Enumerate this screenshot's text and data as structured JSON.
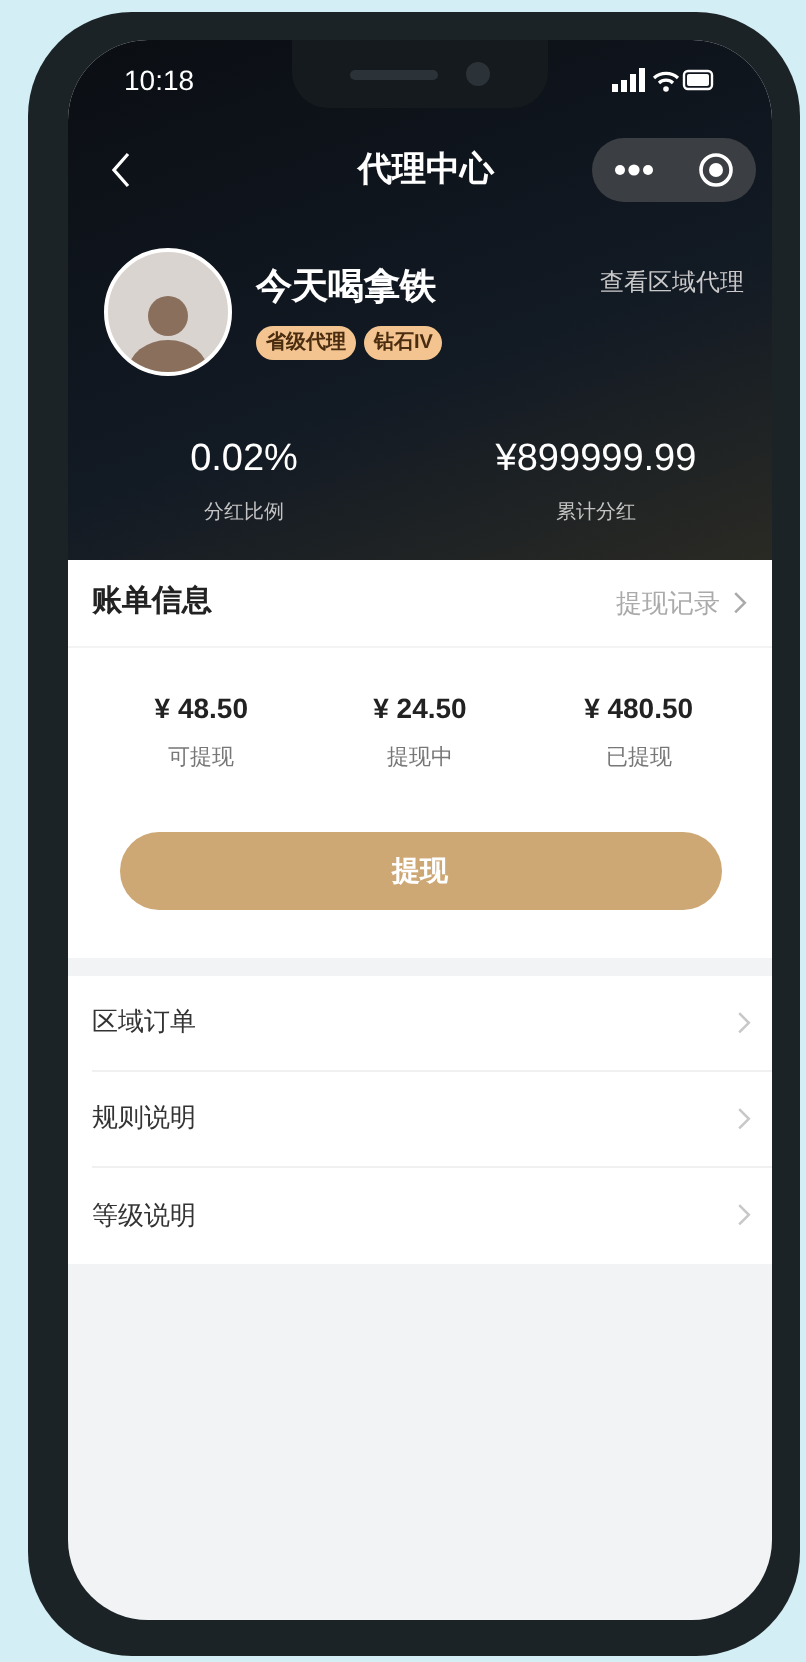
{
  "status_bar": {
    "time": "10:18"
  },
  "nav": {
    "title": "代理中心"
  },
  "profile": {
    "name": "今天喝拿铁",
    "badges": [
      "省级代理",
      "钻石IV"
    ],
    "link": "查看区域代理"
  },
  "stats": [
    {
      "value": "0.02%",
      "label": "分红比例"
    },
    {
      "value": "¥899999.99",
      "label": "累计分红"
    }
  ],
  "bill": {
    "title": "账单信息",
    "link": "提现记录",
    "amounts": [
      {
        "value": "¥ 48.50",
        "label": "可提现"
      },
      {
        "value": "¥ 24.50",
        "label": "提现中"
      },
      {
        "value": "¥ 480.50",
        "label": "已提现"
      }
    ],
    "button": "提现"
  },
  "menu": [
    "区域订单",
    "规则说明",
    "等级说明"
  ]
}
